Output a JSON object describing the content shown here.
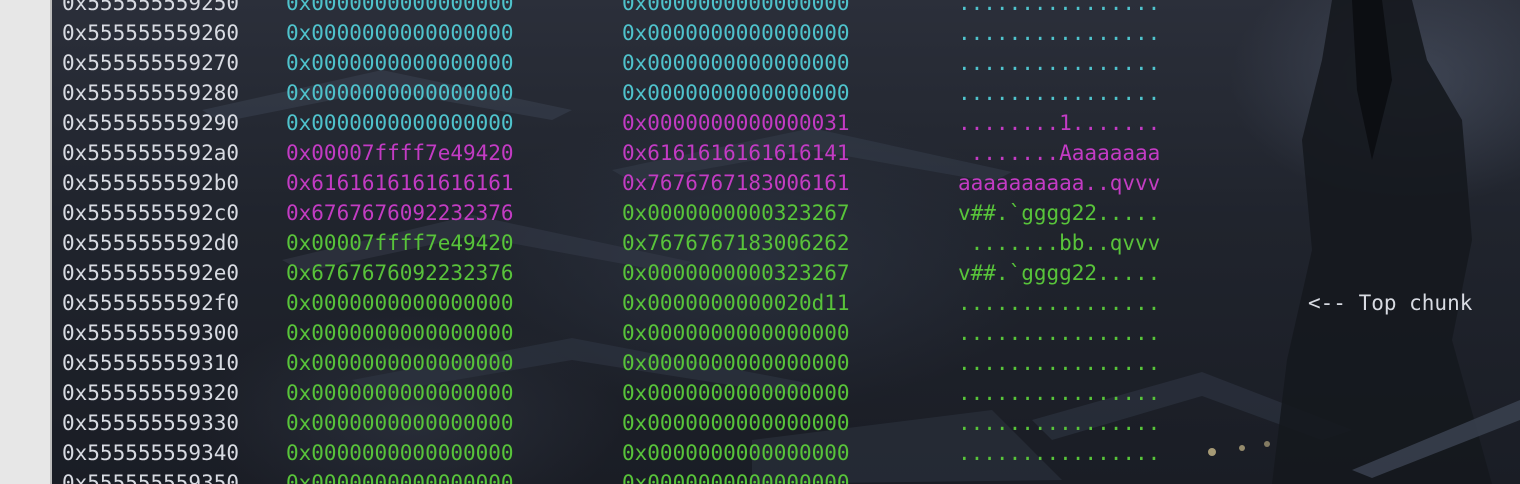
{
  "colors": {
    "address": "#d8dbe2",
    "cyan": "#4fc3cc",
    "magenta": "#c33bc4",
    "green": "#58c43a"
  },
  "rows": [
    {
      "addr": "0x555555559250",
      "w1": "0x0000000000000000",
      "w1c": "cyan",
      "w2": "0x0000000000000000",
      "w2c": "cyan",
      "ascii": "................",
      "ac": "cyan"
    },
    {
      "addr": "0x555555559260",
      "w1": "0x0000000000000000",
      "w1c": "cyan",
      "w2": "0x0000000000000000",
      "w2c": "cyan",
      "ascii": "................",
      "ac": "cyan"
    },
    {
      "addr": "0x555555559270",
      "w1": "0x0000000000000000",
      "w1c": "cyan",
      "w2": "0x0000000000000000",
      "w2c": "cyan",
      "ascii": "................",
      "ac": "cyan"
    },
    {
      "addr": "0x555555559280",
      "w1": "0x0000000000000000",
      "w1c": "cyan",
      "w2": "0x0000000000000000",
      "w2c": "cyan",
      "ascii": "................",
      "ac": "cyan"
    },
    {
      "addr": "0x555555559290",
      "w1": "0x0000000000000000",
      "w1c": "cyan",
      "w2": "0x0000000000000031",
      "w2c": "magenta",
      "ascii": "........1.......",
      "ac": "magenta"
    },
    {
      "addr": "0x5555555592a0",
      "w1": "0x00007ffff7e49420",
      "w1c": "magenta",
      "w2": "0x6161616161616141",
      "w2c": "magenta",
      "ascii": " .......Aaaaaaaa",
      "ac": "magenta"
    },
    {
      "addr": "0x5555555592b0",
      "w1": "0x6161616161616161",
      "w1c": "magenta",
      "w2": "0x7676767183006161",
      "w2c": "magenta",
      "ascii": "aaaaaaaaaa..qvvv",
      "ac": "magenta"
    },
    {
      "addr": "0x5555555592c0",
      "w1": "0x6767676092232376",
      "w1c": "magenta",
      "w2": "0x0000000000323267",
      "w2c": "green",
      "ascii": "v##.`gggg22.....",
      "ac": "green"
    },
    {
      "addr": "0x5555555592d0",
      "w1": "0x00007ffff7e49420",
      "w1c": "green",
      "w2": "0x7676767183006262",
      "w2c": "green",
      "ascii": " .......bb..qvvv",
      "ac": "green"
    },
    {
      "addr": "0x5555555592e0",
      "w1": "0x6767676092232376",
      "w1c": "green",
      "w2": "0x0000000000323267",
      "w2c": "green",
      "ascii": "v##.`gggg22.....",
      "ac": "green"
    },
    {
      "addr": "0x5555555592f0",
      "w1": "0x0000000000000000",
      "w1c": "green",
      "w2": "0x0000000000020d11",
      "w2c": "green",
      "ascii": "................",
      "ac": "green",
      "note": "<-- Top chunk"
    },
    {
      "addr": "0x555555559300",
      "w1": "0x0000000000000000",
      "w1c": "green",
      "w2": "0x0000000000000000",
      "w2c": "green",
      "ascii": "................",
      "ac": "green"
    },
    {
      "addr": "0x555555559310",
      "w1": "0x0000000000000000",
      "w1c": "green",
      "w2": "0x0000000000000000",
      "w2c": "green",
      "ascii": "................",
      "ac": "green"
    },
    {
      "addr": "0x555555559320",
      "w1": "0x0000000000000000",
      "w1c": "green",
      "w2": "0x0000000000000000",
      "w2c": "green",
      "ascii": "................",
      "ac": "green"
    },
    {
      "addr": "0x555555559330",
      "w1": "0x0000000000000000",
      "w1c": "green",
      "w2": "0x0000000000000000",
      "w2c": "green",
      "ascii": "................",
      "ac": "green"
    },
    {
      "addr": "0x555555559340",
      "w1": "0x0000000000000000",
      "w1c": "green",
      "w2": "0x0000000000000000",
      "w2c": "green",
      "ascii": "................",
      "ac": "green"
    },
    {
      "addr": "0x555555559350",
      "w1": "0x0000000000000000",
      "w1c": "green",
      "w2": "0x0000000000000000",
      "w2c": "green",
      "ascii": "................",
      "ac": "green"
    }
  ]
}
